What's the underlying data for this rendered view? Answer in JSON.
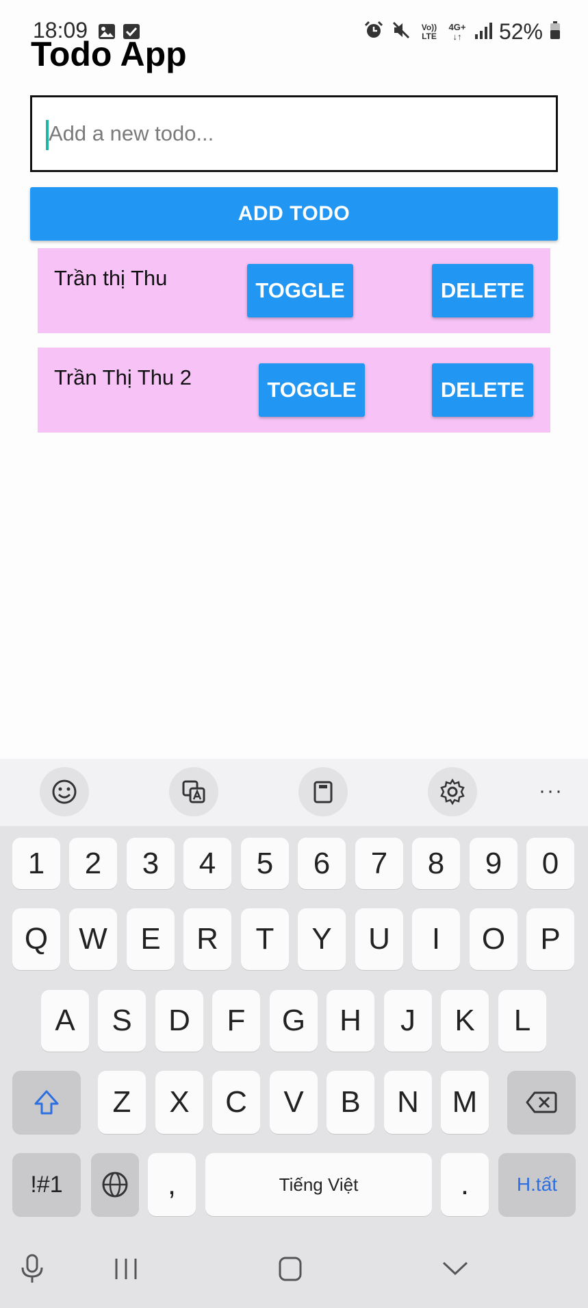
{
  "status_bar": {
    "time": "18:09",
    "battery": "52%",
    "icons": [
      "image-icon",
      "checkbox-icon",
      "alarm-icon",
      "mute-icon",
      "volte-icon",
      "4g-icon",
      "signal-icon",
      "battery-icon"
    ],
    "network_label_top": "Vo))",
    "network_label_bottom": "LTE",
    "data_label": "4G+"
  },
  "app": {
    "title": "Todo App",
    "input": {
      "placeholder": "Add a new todo...",
      "value": ""
    },
    "add_button": "ADD TODO",
    "todos": [
      {
        "text": "Trần thị Thu",
        "toggle": "TOGGLE",
        "delete": "DELETE"
      },
      {
        "text": "Trần Thị Thu 2",
        "toggle": "TOGGLE",
        "delete": "DELETE"
      }
    ],
    "colors": {
      "accent": "#2196f3",
      "item_bg": "#f7c3f7"
    }
  },
  "keyboard": {
    "toolbar": [
      "emoji-icon",
      "translate-icon",
      "clipboard-icon",
      "settings-icon",
      "more-icon"
    ],
    "more_label": "···",
    "row_numbers": [
      "1",
      "2",
      "3",
      "4",
      "5",
      "6",
      "7",
      "8",
      "9",
      "0"
    ],
    "row1": [
      "Q",
      "W",
      "E",
      "R",
      "T",
      "Y",
      "U",
      "I",
      "O",
      "P"
    ],
    "row2": [
      "A",
      "S",
      "D",
      "F",
      "G",
      "H",
      "J",
      "K",
      "L"
    ],
    "row3": [
      "Z",
      "X",
      "C",
      "V",
      "B",
      "N",
      "M"
    ],
    "symbols": "!#1",
    "comma": ",",
    "space": "Tiếng Việt",
    "period": ".",
    "done": "H.tất"
  }
}
